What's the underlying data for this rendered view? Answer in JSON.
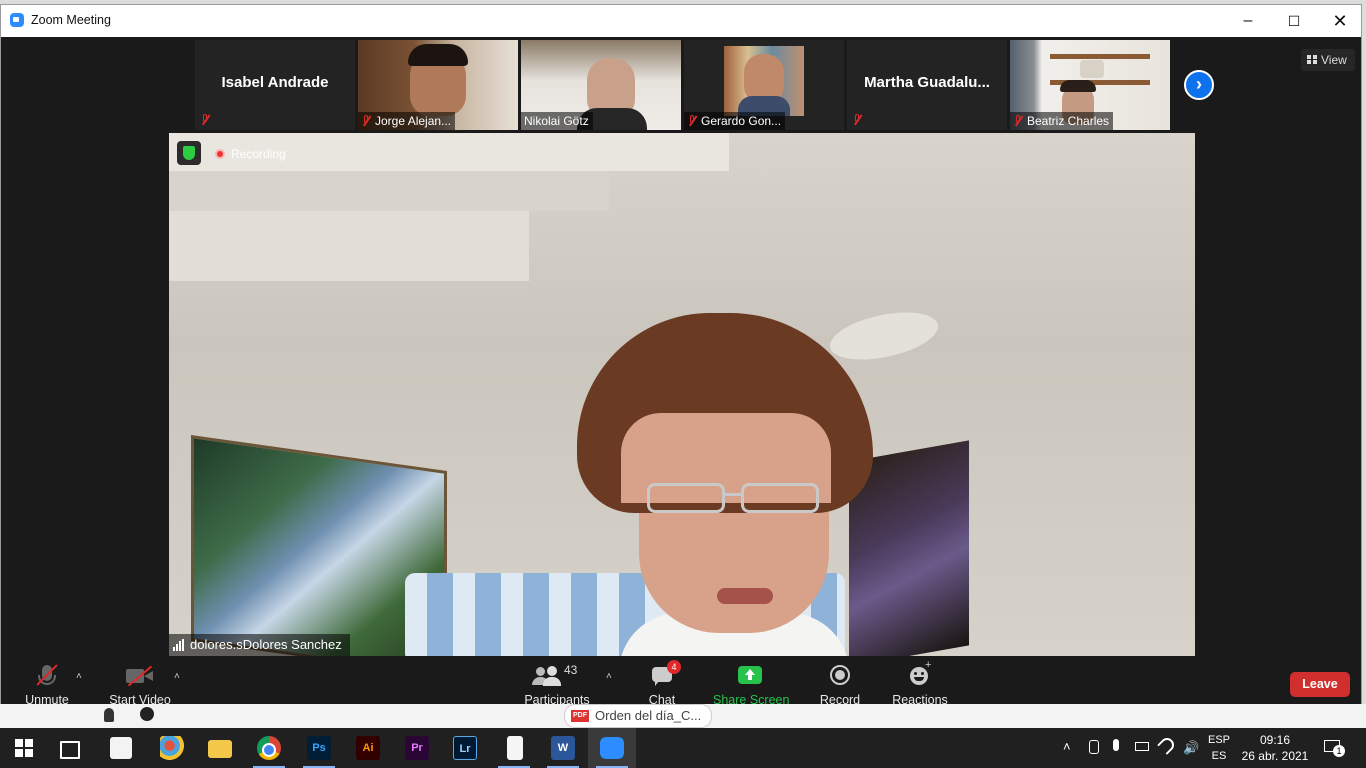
{
  "window": {
    "title": "Zoom Meeting"
  },
  "thumbnails": [
    {
      "name": "Isabel Andrade",
      "big_label": true,
      "muted": true
    },
    {
      "name": "Jorge Alejan...",
      "big_label": false,
      "muted": true
    },
    {
      "name": "Nikolai Götz",
      "big_label": false,
      "muted": false
    },
    {
      "name": "Gerardo Gon...",
      "big_label": false,
      "muted": true
    },
    {
      "name": "Martha  Guadalu...",
      "big_label": true,
      "muted": true
    },
    {
      "name": "Beatriz Charles",
      "big_label": false,
      "muted": true
    }
  ],
  "view_label": "View",
  "main": {
    "recording_label": "Recording",
    "speaker_label": "dolores.sDolores Sanchez"
  },
  "toolbar": {
    "unmute": "Unmute",
    "start_video": "Start Video",
    "participants": "Participants",
    "participants_count": "43",
    "chat": "Chat",
    "chat_badge": "4",
    "share_screen": "Share Screen",
    "record": "Record",
    "reactions": "Reactions",
    "leave": "Leave"
  },
  "behind": {
    "pdf_badge": "PDF",
    "pdf_title": "Orden del día_C..."
  },
  "taskbar": {
    "apps": [
      "start",
      "task-view",
      "store",
      "paint",
      "file-explorer",
      "chrome",
      "photoshop",
      "illustrator",
      "premiere",
      "lightroom",
      "notepad",
      "word",
      "zoom"
    ],
    "ps": "Ps",
    "ai": "Ai",
    "pr": "Pr",
    "lr": "Lr",
    "lang_top": "ESP",
    "lang_bottom": "ES",
    "time": "09:16",
    "date": "26 abr. 2021",
    "notifications": "1"
  },
  "colors": {
    "accent": "#0e72ed",
    "leave": "#d12e2e",
    "share": "#27c24c",
    "toolbar_bg": "#1a1a1a"
  }
}
